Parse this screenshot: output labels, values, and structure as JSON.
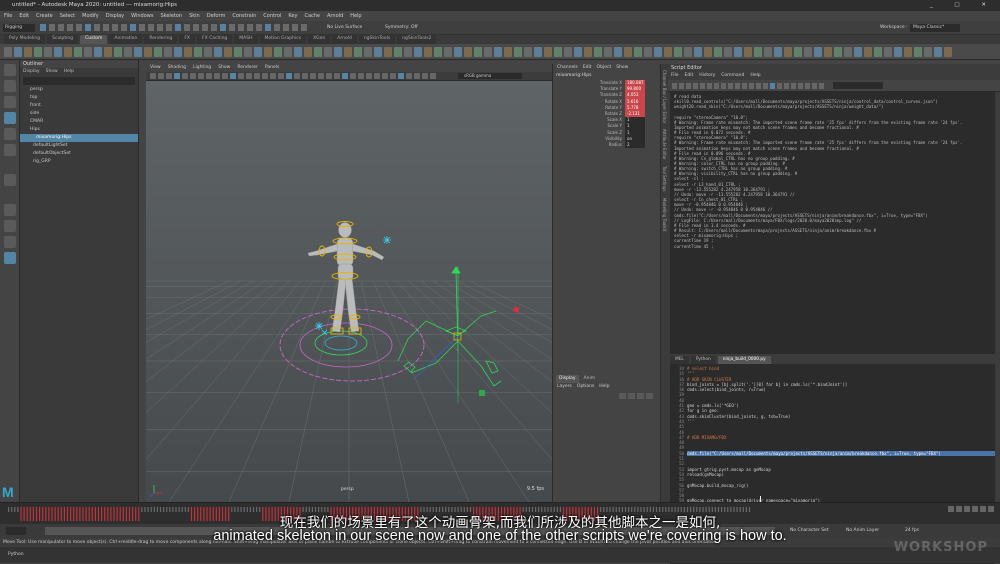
{
  "window": {
    "title": "untitled* - Autodesk Maya 2020: untitled   ---   mixamorig:Hips",
    "controls": "_ □ ✕"
  },
  "menu": [
    "File",
    "Edit",
    "Create",
    "Select",
    "Modify",
    "Display",
    "Windows",
    "Skeleton",
    "Skin",
    "Deform",
    "Constrain",
    "Control",
    "Key",
    "Cache",
    "Arnold",
    "Help"
  ],
  "status_line": {
    "mode": "Rigging",
    "live_surface": "No Live Surface",
    "symmetry": "Symmetry: Off",
    "workspace_label": "Workspace :",
    "workspace": "Maya Classic*"
  },
  "shelf_tabs": [
    "Poly Modeling",
    "Sculpting",
    "Custom",
    "Animation",
    "Rendering",
    "FX",
    "FX Caching",
    "MASH",
    "Motion Graphics",
    "XGen",
    "Arnold",
    "ngSkinTools",
    "ngSkinTools2"
  ],
  "shelf_active": "Custom",
  "outliner": {
    "title": "Outliner",
    "menu": [
      "Display",
      "Show",
      "Help"
    ],
    "items": [
      "persp",
      "top",
      "front",
      "side",
      "CMAR",
      "Hips",
      "mixamorig:Hips",
      "defaultLightSet",
      "defaultObjectSet",
      "rig_GRP"
    ],
    "selected": "mixamorig:Hips"
  },
  "viewport": {
    "menu": [
      "View",
      "Shading",
      "Lighting",
      "Show",
      "Renderer",
      "Panels"
    ],
    "colorspace": "sRGB gamma",
    "camera": "persp",
    "fps": "9.5 fps"
  },
  "channel_box": {
    "menu": [
      "Channels",
      "Edit",
      "Object",
      "Show"
    ],
    "object": "mixamorig:Hips",
    "channels": [
      {
        "name": "Translate X",
        "value": "180.087",
        "keyed": true
      },
      {
        "name": "Translate Y",
        "value": "99.800",
        "keyed": true
      },
      {
        "name": "Translate Z",
        "value": "4.053",
        "keyed": true
      },
      {
        "name": "Rotate X",
        "value": "5.616",
        "keyed": true
      },
      {
        "name": "Rotate Y",
        "value": "5.778",
        "keyed": true
      },
      {
        "name": "Rotate Z",
        "value": "-2.131",
        "keyed": true
      },
      {
        "name": "Scale X",
        "value": "1",
        "keyed": false
      },
      {
        "name": "Scale Y",
        "value": "1",
        "keyed": false
      },
      {
        "name": "Scale Z",
        "value": "1",
        "keyed": false
      },
      {
        "name": "Visibility",
        "value": "on",
        "keyed": false
      },
      {
        "name": "Radius",
        "value": "2",
        "keyed": false
      }
    ]
  },
  "layer_editor": {
    "tabs": [
      "Display",
      "Anim"
    ],
    "menu": [
      "Layers",
      "Options",
      "Help"
    ]
  },
  "side_tabs": [
    "Channel Box / Layer Editor",
    "Attribute Editor",
    "Tool Settings",
    "Modelling Toolkit"
  ],
  "script_editor": {
    "title": "Script Editor",
    "menu": [
      "File",
      "Edit",
      "History",
      "Command",
      "Help"
    ],
    "history": [
      "# read data",
      "skill0.read_controls(\"C:/Users/mall/Documents/maya/projects/ASSETS/ninja/control_data/control_curves.json\")",
      "weight20.read_skin(\"C:/Users/mall/Documents/maya/projects/ASSETS/ninja/weight_data/\")",
      "",
      "require \"stereoCamera\" \"10.0\";",
      "# Warning: Frame rate mismatch:  The imported scene frame rate '25 fps' differs from the existing frame rate '24 fps'.",
      "Imported animation keys may not match scene frames and become fractional. #",
      "# File read in  0.072 seconds. #",
      "require \"stereoCamera\" \"10.0\";",
      "# Warning: Frame rate mismatch:  The imported scene frame rate '25 fps' differs from the existing frame rate '24 fps'.",
      "Imported animation keys may not match scene frames and become fractional. #",
      "# File read in  0.096 seconds. #",
      "# Warning: Cn_global_CTRL has no group padding. #",
      "# Warning: color_CTRL has no group padding. #",
      "# Warning: switch_CTRL has no group padding. #",
      "# Warning: visibility_CTRL has no group padding. #",
      "select -cl ;",
      "select -r L3_hand_01_CTRL ;",
      "move -r -13.555282 4.247958 10.364791 ;",
      "// Undo: move -r -13.555282 4.247958 10.364791 //",
      "select -r Cn_chest_01_CTRL ;",
      "move -r -0.954846 0 0.954846 ;",
      "// Undo: move -r -0.954846 0 0.954846 //",
      "cmds.file(\"C:/Users/mall/Documents/maya/projects/ASSETS/ninja/anim/breakdance.fbx\", i=True, type=\"FBX\")",
      "// LogFile: C:/Users/mall/Documents/maya/FBX/logs/2020.0/maya2020imp.log\" //",
      "# File read in  1.4 seconds. #",
      "# Result: C:/Users/mall/Documents/maya/projects/ASSETS/ninja/anim/breakdance.fbx #",
      "select -r mixamorig:Hips ;",
      "currentTime 19 ;",
      "currentTime 45 ;"
    ],
    "tabs": [
      "MEL",
      "Python",
      "ninja_build_0000.py"
    ],
    "active_tab": "ninja_build_0000.py",
    "code": [
      {
        "n": "34",
        "t": "# select bind",
        "c": "cmt"
      },
      {
        "n": "35",
        "t": "'''",
        "c": ""
      },
      {
        "n": "36",
        "t": "# ADD SKIN CLUSTER",
        "c": "cmt"
      },
      {
        "n": "37",
        "t": "bind_joints = [bj.split('.')[0] for bj in cmds.ls('*.bindJoint')]",
        "c": ""
      },
      {
        "n": "38",
        "t": "cmds.select(bind_joints, r=True)",
        "c": ""
      },
      {
        "n": "39",
        "t": "",
        "c": ""
      },
      {
        "n": "40",
        "t": "",
        "c": ""
      },
      {
        "n": "41",
        "t": "geo = cmds.ls('*GEO')",
        "c": ""
      },
      {
        "n": "42",
        "t": "for g in geo:",
        "c": ""
      },
      {
        "n": "43",
        "t": "    cmds.skinCluster(bind_joints, g, tsb=True)",
        "c": ""
      },
      {
        "n": "44",
        "t": "'''",
        "c": ""
      },
      {
        "n": "45",
        "t": "",
        "c": ""
      },
      {
        "n": "46",
        "t": "",
        "c": ""
      },
      {
        "n": "47",
        "t": "# ADD MIXAMO/FBX",
        "c": "cmt"
      },
      {
        "n": "48",
        "t": "",
        "c": ""
      },
      {
        "n": "49",
        "t": "",
        "c": ""
      },
      {
        "n": "50",
        "t": "cmds.file(\"C:/Users/mall/Documents/maya/projects/ASSETS/ninja/anim/breakdance.fbx\", i=True, type=\"FBX\")",
        "c": "hl"
      },
      {
        "n": "51",
        "t": "",
        "c": ""
      },
      {
        "n": "52",
        "t": "",
        "c": ""
      },
      {
        "n": "53",
        "t": "import gtrig.pyst.mocap as gnMocap",
        "c": ""
      },
      {
        "n": "54",
        "t": "reload(gnMocap)",
        "c": ""
      },
      {
        "n": "55",
        "t": "",
        "c": ""
      },
      {
        "n": "56",
        "t": "gnMocap.build_mocap_rig()",
        "c": ""
      },
      {
        "n": "57",
        "t": "",
        "c": ""
      },
      {
        "n": "58",
        "t": "",
        "c": ""
      },
      {
        "n": "59",
        "t": "gnMocap.connect_to_mocap(driver_namespace=\"mixamorig\")",
        "c": ""
      },
      {
        "n": "60",
        "t": "",
        "c": ""
      },
      {
        "n": "61",
        "t": "",
        "c": ""
      },
      {
        "n": "62",
        "t": "gnMocap.bake_to_controls()",
        "c": ""
      }
    ]
  },
  "time_slider": {
    "no_character_set": "No Character Set",
    "no_anim_layer": "No Anim Layer",
    "fps": "24 fps"
  },
  "help_line": "Move Tool: Use manipulator to move object(s). Ctrl+middle-drag to move components along normals. Shift+drag manipulator axis or plane handle to extrude components or clone objects. Ctrl+Shift+drag to constrain movement to a connected edge. Use D or INSERT to change the pivot position and axis orientation.",
  "command_line": {
    "lang": "Python"
  },
  "subtitles": {
    "zh": "现在我们的场景里有了这个动画骨架,而我们所涉及的其他脚本之一是如何,",
    "en": "animated skeleton in our scene now and one of the other scripts we're covering is how to."
  },
  "logo": "M",
  "watermark": "WORKSHOP",
  "colors": {
    "selection": "#5285a6",
    "keyed": "#c9474c",
    "bone": "#b9bbbc",
    "control_yellow": "#e9b400",
    "control_green": "#2fd85a",
    "control_pink": "#c868c8"
  }
}
